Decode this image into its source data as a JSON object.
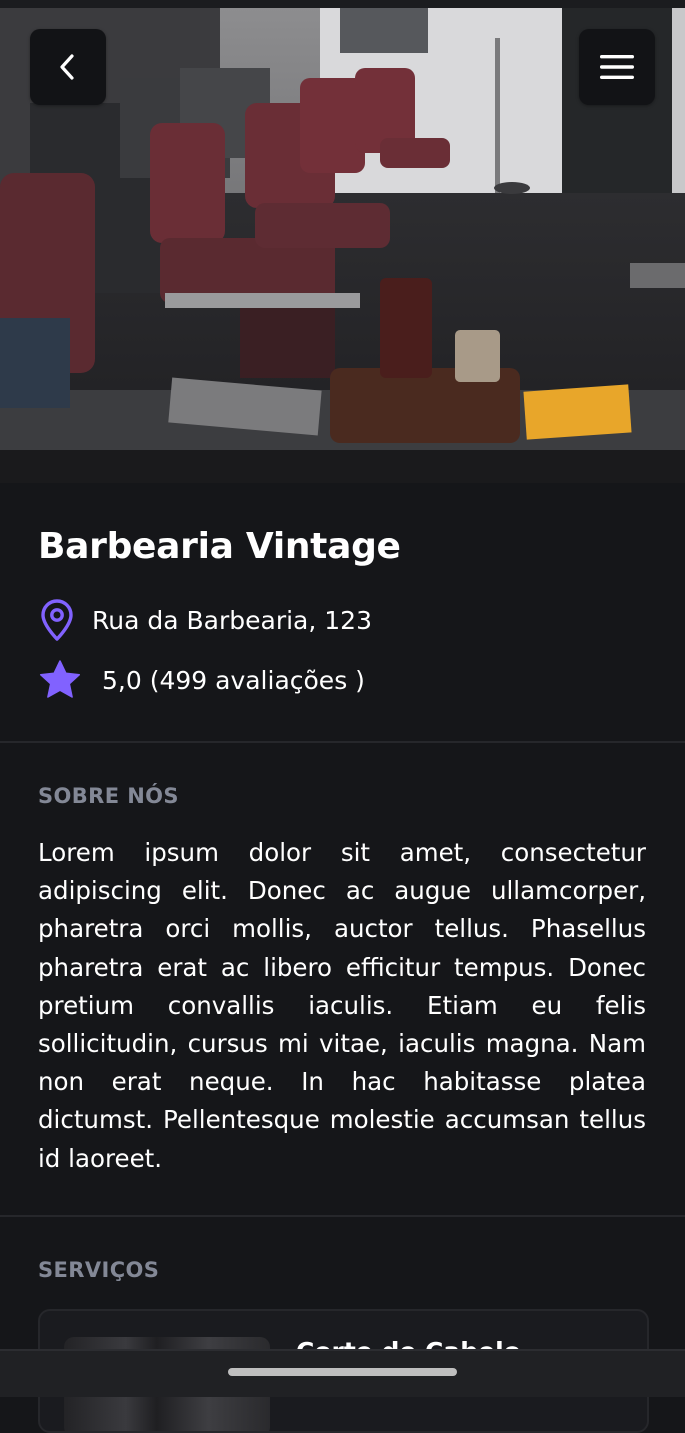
{
  "header": {
    "back_icon": "chevron-left-icon",
    "menu_icon": "hamburger-menu-icon",
    "hero_image": "barbershop-interior-photo"
  },
  "barbershop": {
    "name": "Barbearia Vintage",
    "address": "Rua da Barbearia, 123",
    "rating": "5,0 (499 avaliações )",
    "location_icon": "map-pin-icon",
    "rating_icon": "star-icon"
  },
  "about": {
    "title": "SOBRE NÓS",
    "text": "Lorem ipsum dolor sit amet, consectetur adipiscing elit. Donec ac augue ullamcorper, pharetra orci mollis, auctor tellus. Phasellus pharetra erat ac libero efficitur tempus. Donec pretium convallis iaculis. Etiam eu felis sollicitudin, cursus mi vitae, iaculis magna. Nam non erat neque. In hac habitasse platea dictumst. Pellentesque molestie accumsan tellus id laoreet."
  },
  "services": {
    "title": "SERVIÇOS",
    "items": [
      {
        "name": "Corte de Cabelo"
      }
    ]
  },
  "colors": {
    "background": "#151619",
    "accent": "#8162ff",
    "muted_text": "#838896",
    "divider": "#26272b"
  }
}
